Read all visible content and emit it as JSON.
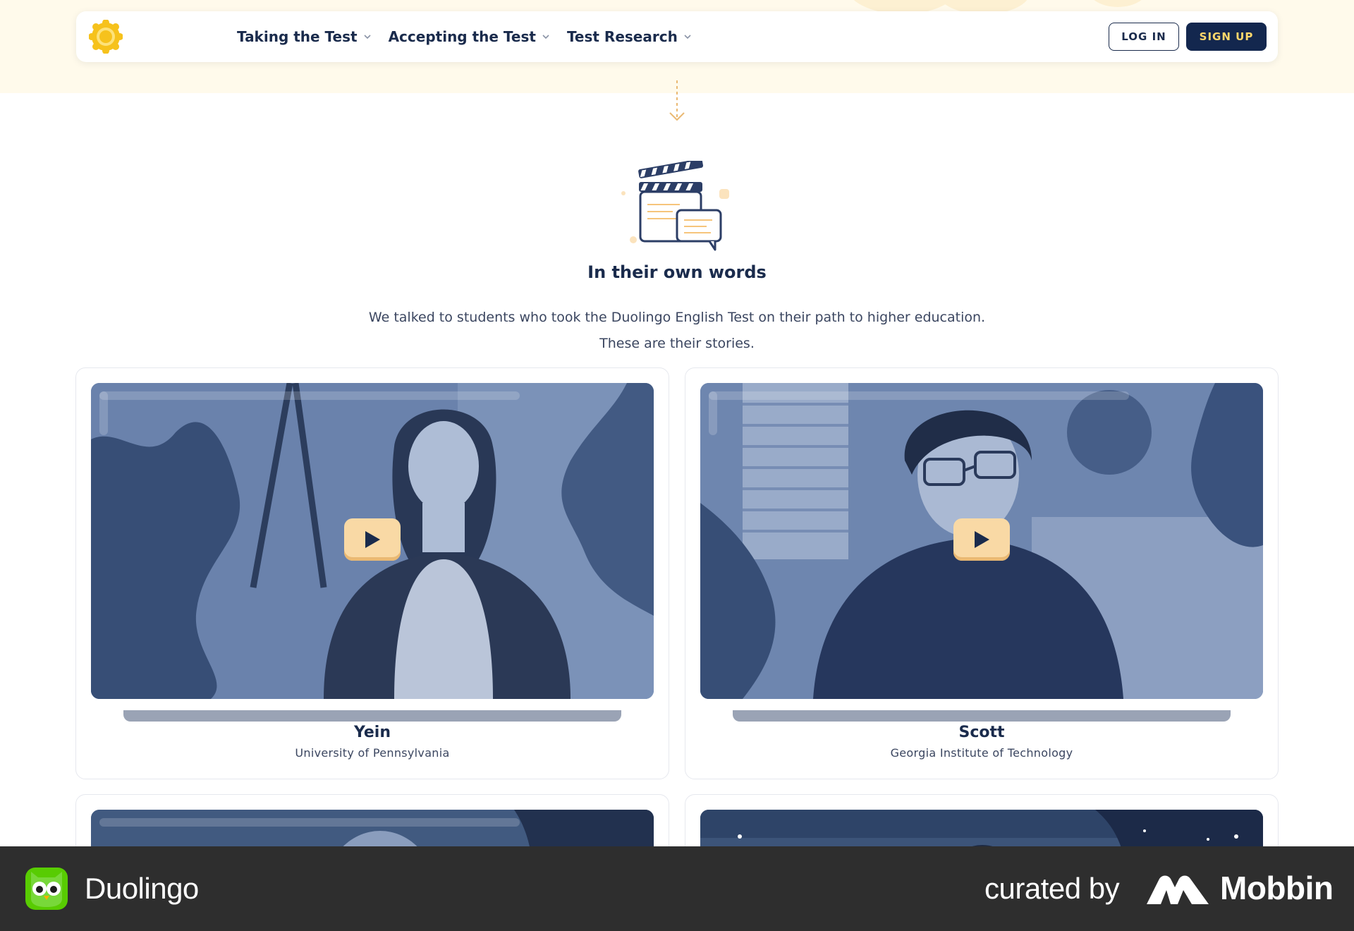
{
  "nav": {
    "links": [
      {
        "label": "Taking the Test",
        "active": true
      },
      {
        "label": "Accepting the Test",
        "active": false
      },
      {
        "label": "Test Research",
        "active": false
      }
    ],
    "login_label": "LOG IN",
    "signup_label": "SIGN UP"
  },
  "section": {
    "title": "In their own words",
    "desc_line1": "We talked to students who took the Duolingo English Test on their path to higher education.",
    "desc_line2": "These are their stories."
  },
  "stories": [
    {
      "name": "Yein",
      "school": "University of Pennsylvania"
    },
    {
      "name": "Scott",
      "school": "Georgia Institute of Technology"
    }
  ],
  "footer": {
    "brand": "Duolingo",
    "curated_label": "curated by",
    "curator": "Mobbin"
  },
  "colors": {
    "navy": "#13274e",
    "accent_yellow": "#ffd86b",
    "play_button": "#f9d9a5",
    "band": "#fffaeb",
    "footer_bg": "#2e2e2e"
  }
}
